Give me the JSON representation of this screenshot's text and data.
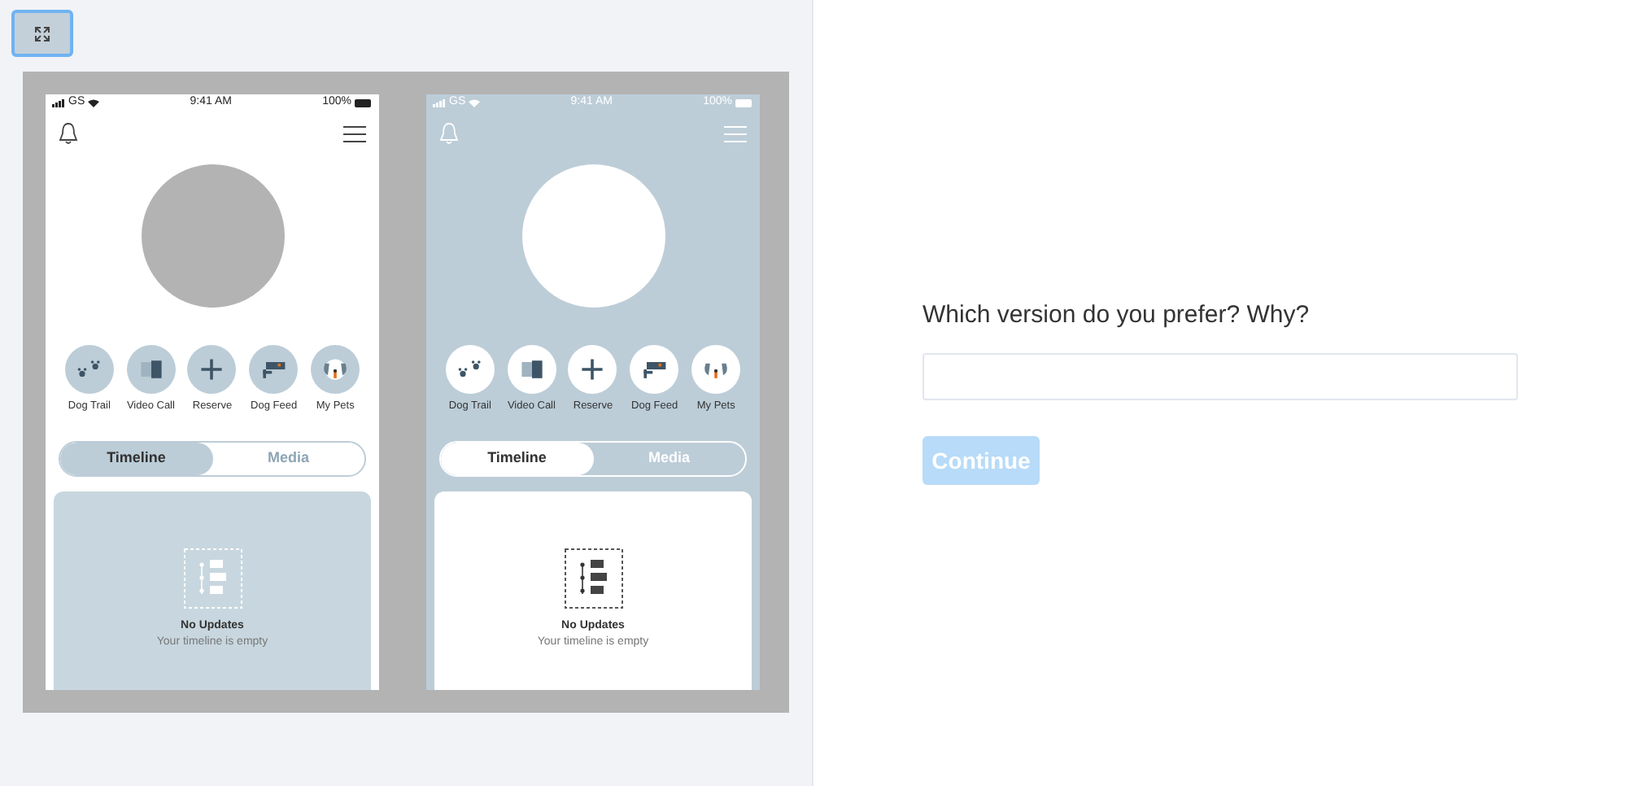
{
  "versions": [
    {
      "kind": "light",
      "status_bar": {
        "carrier": "GS",
        "time": "9:41 AM",
        "battery": "100%"
      },
      "shortcuts": [
        "Dog Trail",
        "Video Call",
        "Reserve",
        "Dog Feed",
        "My Pets"
      ],
      "tabs": [
        {
          "label": "Timeline",
          "selected": true
        },
        {
          "label": "Media",
          "selected": false
        }
      ],
      "empty_state": {
        "title": "No Updates",
        "subtitle": "Your timeline is empty"
      }
    },
    {
      "kind": "blue",
      "status_bar": {
        "carrier": "GS",
        "time": "9:41 AM",
        "battery": "100%"
      },
      "shortcuts": [
        "Dog Trail",
        "Video Call",
        "Reserve",
        "Dog Feed",
        "My Pets"
      ],
      "tabs": [
        {
          "label": "Timeline",
          "selected": true
        },
        {
          "label": "Media",
          "selected": false
        }
      ],
      "empty_state": {
        "title": "No Updates",
        "subtitle": "Your timeline is empty"
      }
    }
  ],
  "question": "Which version do you prefer? Why?",
  "continue_button": {
    "label": "Continue",
    "disabled": true
  }
}
